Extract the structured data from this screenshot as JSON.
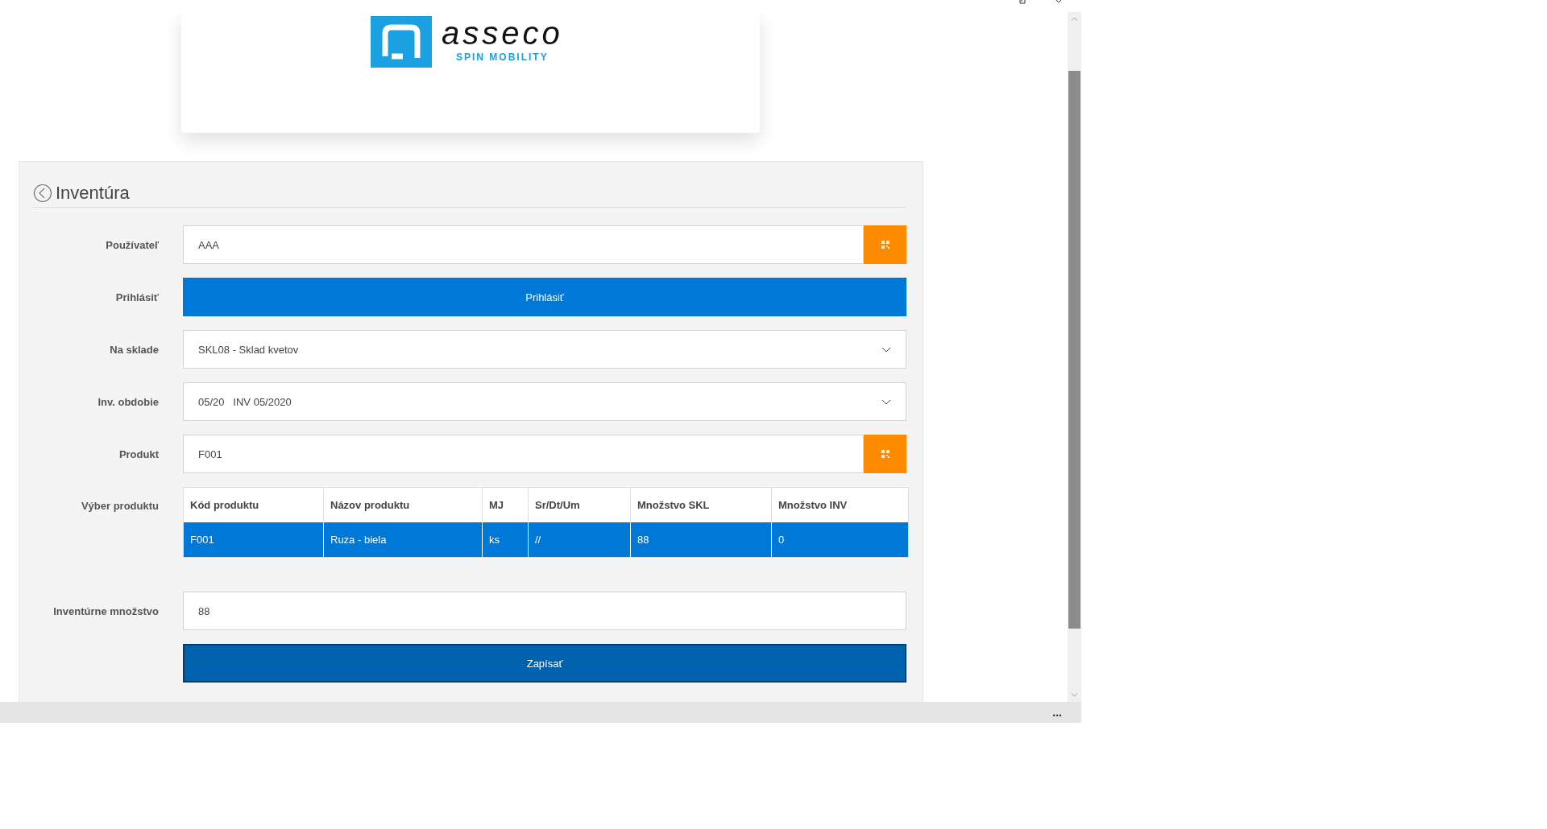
{
  "logo": {
    "wordmark": "asseco",
    "tagline": "SPIN MOBILITY"
  },
  "title": "Inventúra",
  "form": [
    {
      "kind": "scan",
      "label": "Používateľ",
      "value": "AAA"
    },
    {
      "kind": "button",
      "label": "Prihlásiť",
      "button": "Prihlásiť"
    },
    {
      "kind": "select",
      "label": "Na sklade",
      "value": "SKL08 - Sklad kvetov"
    },
    {
      "kind": "select",
      "label": "Inv. obdobie",
      "value": "05/20   INV 05/2020"
    },
    {
      "kind": "scan",
      "label": "Produkt",
      "value": "F001"
    },
    {
      "kind": "table",
      "label": "Výber produktu",
      "columns": [
        "Kód produktu",
        "Názov produktu",
        "MJ",
        "Sr/Dt/Um",
        "Množstvo SKL",
        "Množstvo INV"
      ],
      "rows": [
        {
          "selected": true,
          "cells": [
            "F001",
            "Ruza - biela",
            "ks",
            "//",
            "88",
            "0"
          ]
        }
      ]
    },
    {
      "kind": "input",
      "label": "Inventúrne množstvo",
      "value": "88"
    },
    {
      "kind": "submit",
      "button": "Zapísať"
    }
  ],
  "status_bar": {
    "menu": "..."
  }
}
